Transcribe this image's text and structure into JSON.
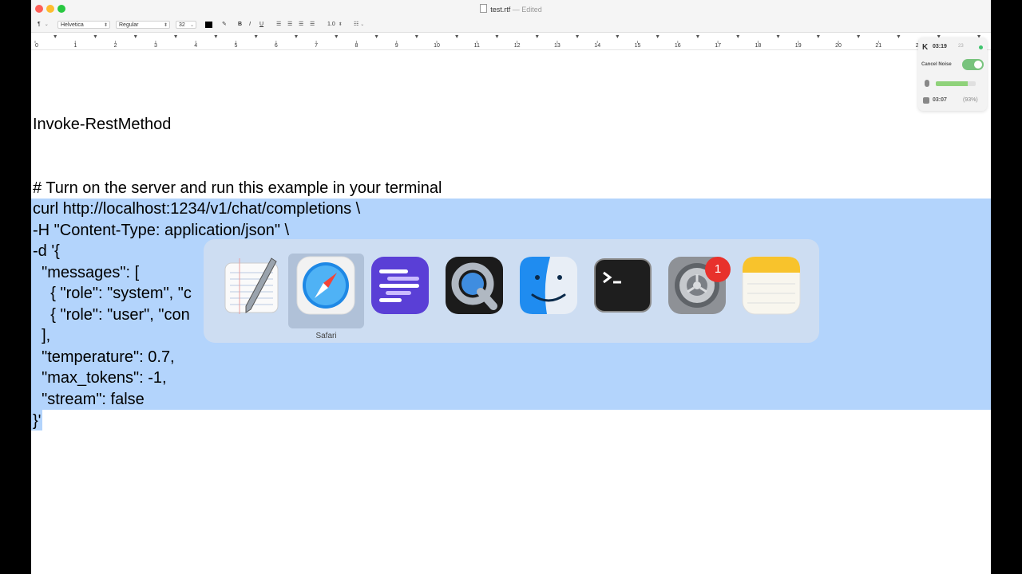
{
  "window": {
    "filename": "test.rtf",
    "separator": "—",
    "status": "Edited"
  },
  "toolbar": {
    "paragraph_style": "¶",
    "font_family": "Helvetica",
    "font_style": "Regular",
    "font_size": "32",
    "text_color": "#000000",
    "bold_label": "B",
    "italic_label": "I",
    "underline_label": "U",
    "line_spacing": "1.0"
  },
  "ruler": {
    "marks": [
      "0",
      "1",
      "2",
      "3",
      "4",
      "5",
      "6",
      "7",
      "8",
      "9",
      "10",
      "11",
      "12",
      "13",
      "14",
      "15",
      "16",
      "17",
      "18",
      "19",
      "20",
      "21",
      "22",
      "23"
    ]
  },
  "document": {
    "lines": [
      "Invoke-RestMethod",
      "# Turn on the server and run this example in your terminal",
      "curl http://localhost:1234/v1/chat/completions \\",
      "-H \"Content-Type: application/json\" \\",
      "-d '{",
      "  \"messages\": [",
      "    { \"role\": \"system\", \"c",
      "    { \"role\": \"user\", \"con",
      "  ],",
      "  \"temperature\": 0.7,",
      "  \"max_tokens\": -1,",
      "  \"stream\": false",
      "}'"
    ]
  },
  "switcher": {
    "apps": [
      {
        "name": "TextEdit",
        "icon": "textedit-icon"
      },
      {
        "name": "Safari",
        "icon": "safari-icon",
        "active": true
      },
      {
        "name": "Linear",
        "icon": "linear-icon"
      },
      {
        "name": "QuickTime Player",
        "icon": "quicktime-icon"
      },
      {
        "name": "Finder",
        "icon": "finder-icon"
      },
      {
        "name": "Terminal",
        "icon": "terminal-icon"
      },
      {
        "name": "System Settings",
        "icon": "system-settings-icon",
        "badge": "1"
      },
      {
        "name": "Notes",
        "icon": "notes-icon"
      }
    ],
    "active_label": "Safari"
  },
  "widget": {
    "logo": "K",
    "session_time": "03:19",
    "extra": "23",
    "cancel_noise_label": "Cancel Noise",
    "cancel_noise_on": true,
    "mic_level": 0.8,
    "speaker_time": "03:07",
    "battery": "(93%)",
    "accent": "#78c37d"
  }
}
